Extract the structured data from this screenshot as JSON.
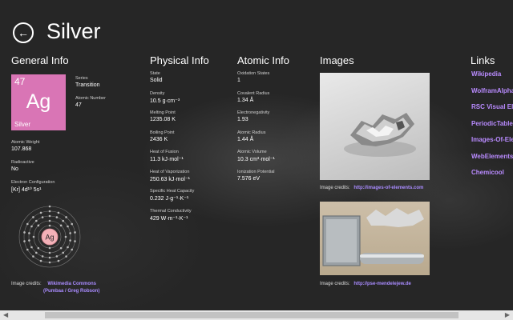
{
  "header": {
    "title": "Silver",
    "back_icon": "back-arrow-icon"
  },
  "general": {
    "heading": "General Info",
    "tile": {
      "number": "47",
      "symbol": "Ag",
      "name": "Silver",
      "color": "#d975b5"
    },
    "series_label": "Series",
    "series_value": "Transition",
    "atomic_number_label": "Atomic Number",
    "atomic_number_value": "47",
    "atomic_weight_label": "Atomic Weight",
    "atomic_weight_value": "107.868",
    "radioactive_label": "Radioactive",
    "radioactive_value": "No",
    "config_label": "Electron Configuration",
    "config_value": "[Kr] 4d¹⁰ 5s¹",
    "bohr_symbol": "Ag",
    "credit_label": "Image credits:",
    "credit_link_1": "Wikimedia Commons",
    "credit_link_2": "(Pumbaa / Greg Robson)"
  },
  "physical": {
    "heading": "Physical Info",
    "rows": [
      {
        "label": "State",
        "value": "Solid"
      },
      {
        "label": "Density",
        "value": "10.5 g·cm⁻³"
      },
      {
        "label": "Melting Point",
        "value": "1235.08 K"
      },
      {
        "label": "Boiling Point",
        "value": "2436 K"
      },
      {
        "label": "Heat of Fusion",
        "value": "11.3 kJ·mol⁻¹"
      },
      {
        "label": "Heat of Vaporization",
        "value": "250.63 kJ·mol⁻¹"
      },
      {
        "label": "Specific Heat Capacity",
        "value": "0.232 J·g⁻¹·K⁻¹"
      },
      {
        "label": "Thermal Conductivity",
        "value": "429 W·m⁻¹·K⁻¹"
      }
    ]
  },
  "atomic": {
    "heading": "Atomic Info",
    "rows": [
      {
        "label": "Oxidation States",
        "value": "1"
      },
      {
        "label": "Covalent Radius",
        "value": "1.34 Å"
      },
      {
        "label": "Electronegativity",
        "value": "1.93"
      },
      {
        "label": "Atomic Radius",
        "value": "1.44 Å"
      },
      {
        "label": "Atomic Volume",
        "value": "10.3 cm³·mol⁻¹"
      },
      {
        "label": "Ionization Potential",
        "value": "7.576 eV"
      }
    ]
  },
  "images": {
    "heading": "Images",
    "credit1_label": "Image credits:",
    "credit1_link": "http://images-of-elements.com",
    "credit2_label": "Image credits:",
    "credit2_link": "http://pse-mendelejew.de"
  },
  "links": {
    "heading": "Links",
    "items": [
      "Wikipedia",
      "WolframAlpha",
      "RSC Visual Ele",
      "PeriodicTable.",
      "Images-Of-Ele",
      "WebElements",
      "Chemicool"
    ]
  },
  "colors": {
    "accent_link": "#b98bff",
    "background": "#2a2a2a"
  }
}
